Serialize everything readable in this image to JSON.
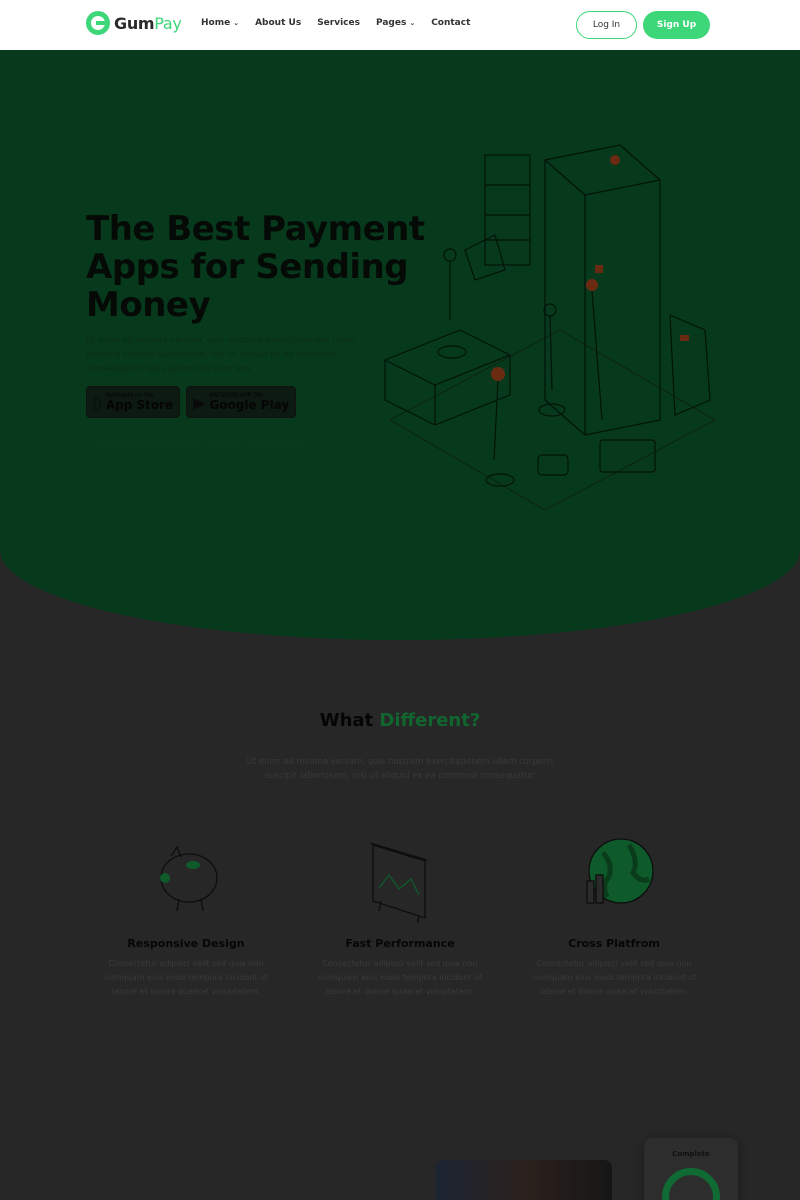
{
  "nav": {
    "logo_main": "Gum",
    "logo_accent": "Pay",
    "items": [
      {
        "label": "Home",
        "has_dropdown": true
      },
      {
        "label": "About Us",
        "has_dropdown": false
      },
      {
        "label": "Services",
        "has_dropdown": false
      },
      {
        "label": "Pages",
        "has_dropdown": true
      },
      {
        "label": "Contact",
        "has_dropdown": false
      }
    ],
    "login_label": "Log In",
    "signup_label": "Sign Up"
  },
  "hero": {
    "title": "The Best Payment Apps for Sending Money",
    "text": "Ut enim ad minima veniam, quis nostrum exercitationem ullam corporis suscipit laboriosam, nisi ut aliquid ex ea commodi consequatur? Quis autem vel eum iure",
    "badges": [
      {
        "small": "Available on the",
        "big": "App Store",
        "icon": "apple-icon"
      },
      {
        "small": "ANDROID APP ON",
        "big": "Google Play",
        "icon": "play-icon"
      }
    ],
    "note": "* Culpa mollitia atque dolores aliquam laborum pariatur"
  },
  "different": {
    "title_main": "What",
    "title_accent": "Different?",
    "text": "Ut enim ad minima veniam, quis nostrum exercitationem ullam corporis suscipit laboriosam, nisi ut aliquid ex ea commodi consequatur.",
    "features": [
      {
        "title": "Responsive Design",
        "text": "Consectetur adipisci velit sed quia non numquam eius modi tempora incidunt ut labore et dolore quaerat voluptatem.",
        "icon": "piggy-bank-icon"
      },
      {
        "title": "Fast Performance",
        "text": "Consectetur adipisci velit sed quia non numquam eius modi tempora incidunt ut labore et dolore quaerat voluptatem.",
        "icon": "chart-board-icon"
      },
      {
        "title": "Cross Platfrom",
        "text": "Consectetur adipisci velit sed quia non numquam eius modi tempora incidunt ut labore et dolore quaerat voluptatem.",
        "icon": "globe-icon"
      }
    ]
  },
  "preview": {
    "complete_label": "Complete"
  },
  "colors": {
    "accent": "#3dd77a",
    "hero_bg": "#073a1c",
    "page_bg": "#272727"
  }
}
